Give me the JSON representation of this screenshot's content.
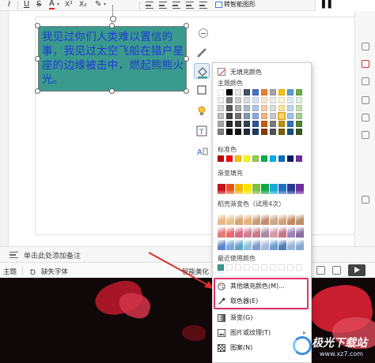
{
  "toolbar": {
    "italic": "I",
    "underline": "U",
    "strike": "S",
    "font_color": "A",
    "superscript": "X²",
    "subscript": "X₂",
    "smart_graphic_label": "转智能图形"
  },
  "textbox": {
    "text": "我见过你们人类难以置信的事，我见过太空飞船在猎户星座的边缘被击中，燃起熊熊火光。",
    "fill_color": "#3a9a8e",
    "text_color": "#1f3bd6"
  },
  "float_bar": [
    "collapse-icon",
    "pen-icon",
    "fill-bucket-icon",
    "outline-icon",
    "bulb-icon",
    "text-box-icon",
    "text-style-icon"
  ],
  "notes": {
    "placeholder": "单击此处添加备注"
  },
  "status": {
    "theme": "主题",
    "missing_font": "缺失字体",
    "smart_beautify": "智能美化"
  },
  "fill_popup": {
    "no_fill": "无填充颜色",
    "theme_colors_label": "主题颜色",
    "standard_colors_label": "标准色",
    "gradient_fill_label": "渐变填充",
    "shine_gradient_label": "稻壳渐变色（试用4次）",
    "recent_colors_label": "最近使用颜色",
    "theme_colors": [
      [
        "#ffffff",
        "#000000",
        "#e7e6e6",
        "#44546a",
        "#4472c4",
        "#ed7d31",
        "#a5a5a5",
        "#ffc000",
        "#5b9bd5",
        "#70ad47"
      ],
      [
        "#f2f2f2",
        "#7f7f7f",
        "#d0cece",
        "#d6dce4",
        "#d9e2f3",
        "#fbe5d5",
        "#ededed",
        "#fff2cc",
        "#deebf6",
        "#e2efd9"
      ],
      [
        "#d8d8d8",
        "#595959",
        "#aeabab",
        "#adb9ca",
        "#b4c6e7",
        "#f7cbac",
        "#dbdbdb",
        "#fee599",
        "#bdd7ee",
        "#c5e0b3"
      ],
      [
        "#bfbfbf",
        "#3f3f3f",
        "#757070",
        "#8496b0",
        "#8eaadb",
        "#f4b183",
        "#c9c9c9",
        "#ffd965",
        "#9cc3e5",
        "#a8d08d"
      ],
      [
        "#a5a5a5",
        "#262626",
        "#3a3838",
        "#323f4f",
        "#2f5496",
        "#c55a11",
        "#7b7b7b",
        "#bf9000",
        "#2e75b5",
        "#538135"
      ],
      [
        "#7f7f7f",
        "#0c0c0c",
        "#171616",
        "#222a35",
        "#1f3864",
        "#833c0b",
        "#525252",
        "#7f6000",
        "#1e4e79",
        "#375623"
      ]
    ],
    "selected_theme_swatch": "3,7",
    "standard_colors": [
      "#c00000",
      "#ff0000",
      "#ffc000",
      "#ffff00",
      "#92d050",
      "#00b050",
      "#00b0f0",
      "#0070c0",
      "#002060",
      "#7030a0"
    ],
    "gradient_colors": [
      "#c0141d",
      "#e8521a",
      "#f2b600",
      "#f7e400",
      "#7bc043",
      "#11a84a",
      "#17a9d8",
      "#1c6fc5",
      "#253a8f",
      "#6a2f9c"
    ],
    "shine_gradients": [
      [
        "#e9b887",
        "#e8c48c",
        "#d6a777",
        "#e6b07e",
        "#c99e72",
        "#c28e6e",
        "#c9a88c",
        "#d4a17c",
        "#c08a65",
        "#b98f6b"
      ],
      [
        "#e07c79",
        "#e86a6a",
        "#d76b84",
        "#cd7f9a",
        "#c97a8a",
        "#a98aa0",
        "#d49aa3",
        "#c6748b",
        "#9a84b6",
        "#8b6f9d"
      ],
      [
        "#5b87c9",
        "#79a7de",
        "#5fa2c9",
        "#8fc3d6",
        "#7d9bd1",
        "#a8b8e0",
        "#6ca0c7",
        "#4f7fb8",
        "#9bb7d4",
        "#86a9cf"
      ]
    ],
    "recent_colors": [
      "#3a9a8e",
      "#ffffff",
      "#ffffff",
      "#ffffff",
      "#ffffff",
      "#ffffff",
      "#ffffff",
      "#ffffff",
      "#ffffff",
      "#ffffff"
    ],
    "menu": [
      {
        "label": "其他填充颜色(M)...",
        "icon": "palette-icon",
        "submenu": false
      },
      {
        "label": "取色器(E)",
        "icon": "eyedropper-icon",
        "submenu": false
      },
      {
        "label": "渐变(G)",
        "icon": "gradient-icon",
        "submenu": false
      },
      {
        "label": "图片或纹理(T)",
        "icon": "picture-icon",
        "submenu": true
      },
      {
        "label": "图案(N)",
        "icon": "pattern-icon",
        "submenu": false
      }
    ]
  },
  "watermark": {
    "name": "极光下载站",
    "url": "www.xz7.com"
  },
  "colors": {
    "highlight": "#e0336b",
    "arrow": "#d9302a"
  }
}
